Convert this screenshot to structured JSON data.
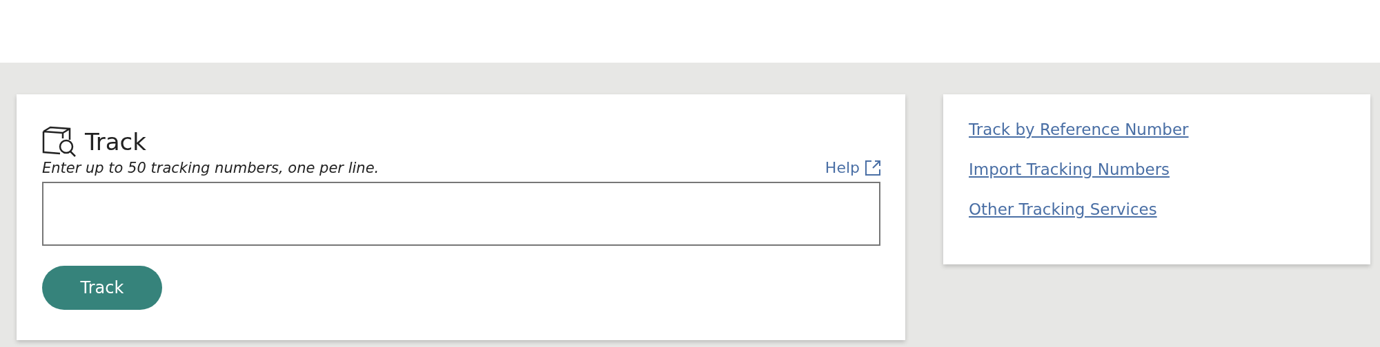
{
  "track_card": {
    "title": "Track",
    "instructions": "Enter up to 50 tracking numbers, one per line.",
    "help_link": "Help",
    "submit_button": "Track"
  },
  "links": [
    "Track by Reference Number",
    "Import Tracking Numbers",
    "Other Tracking Services"
  ]
}
